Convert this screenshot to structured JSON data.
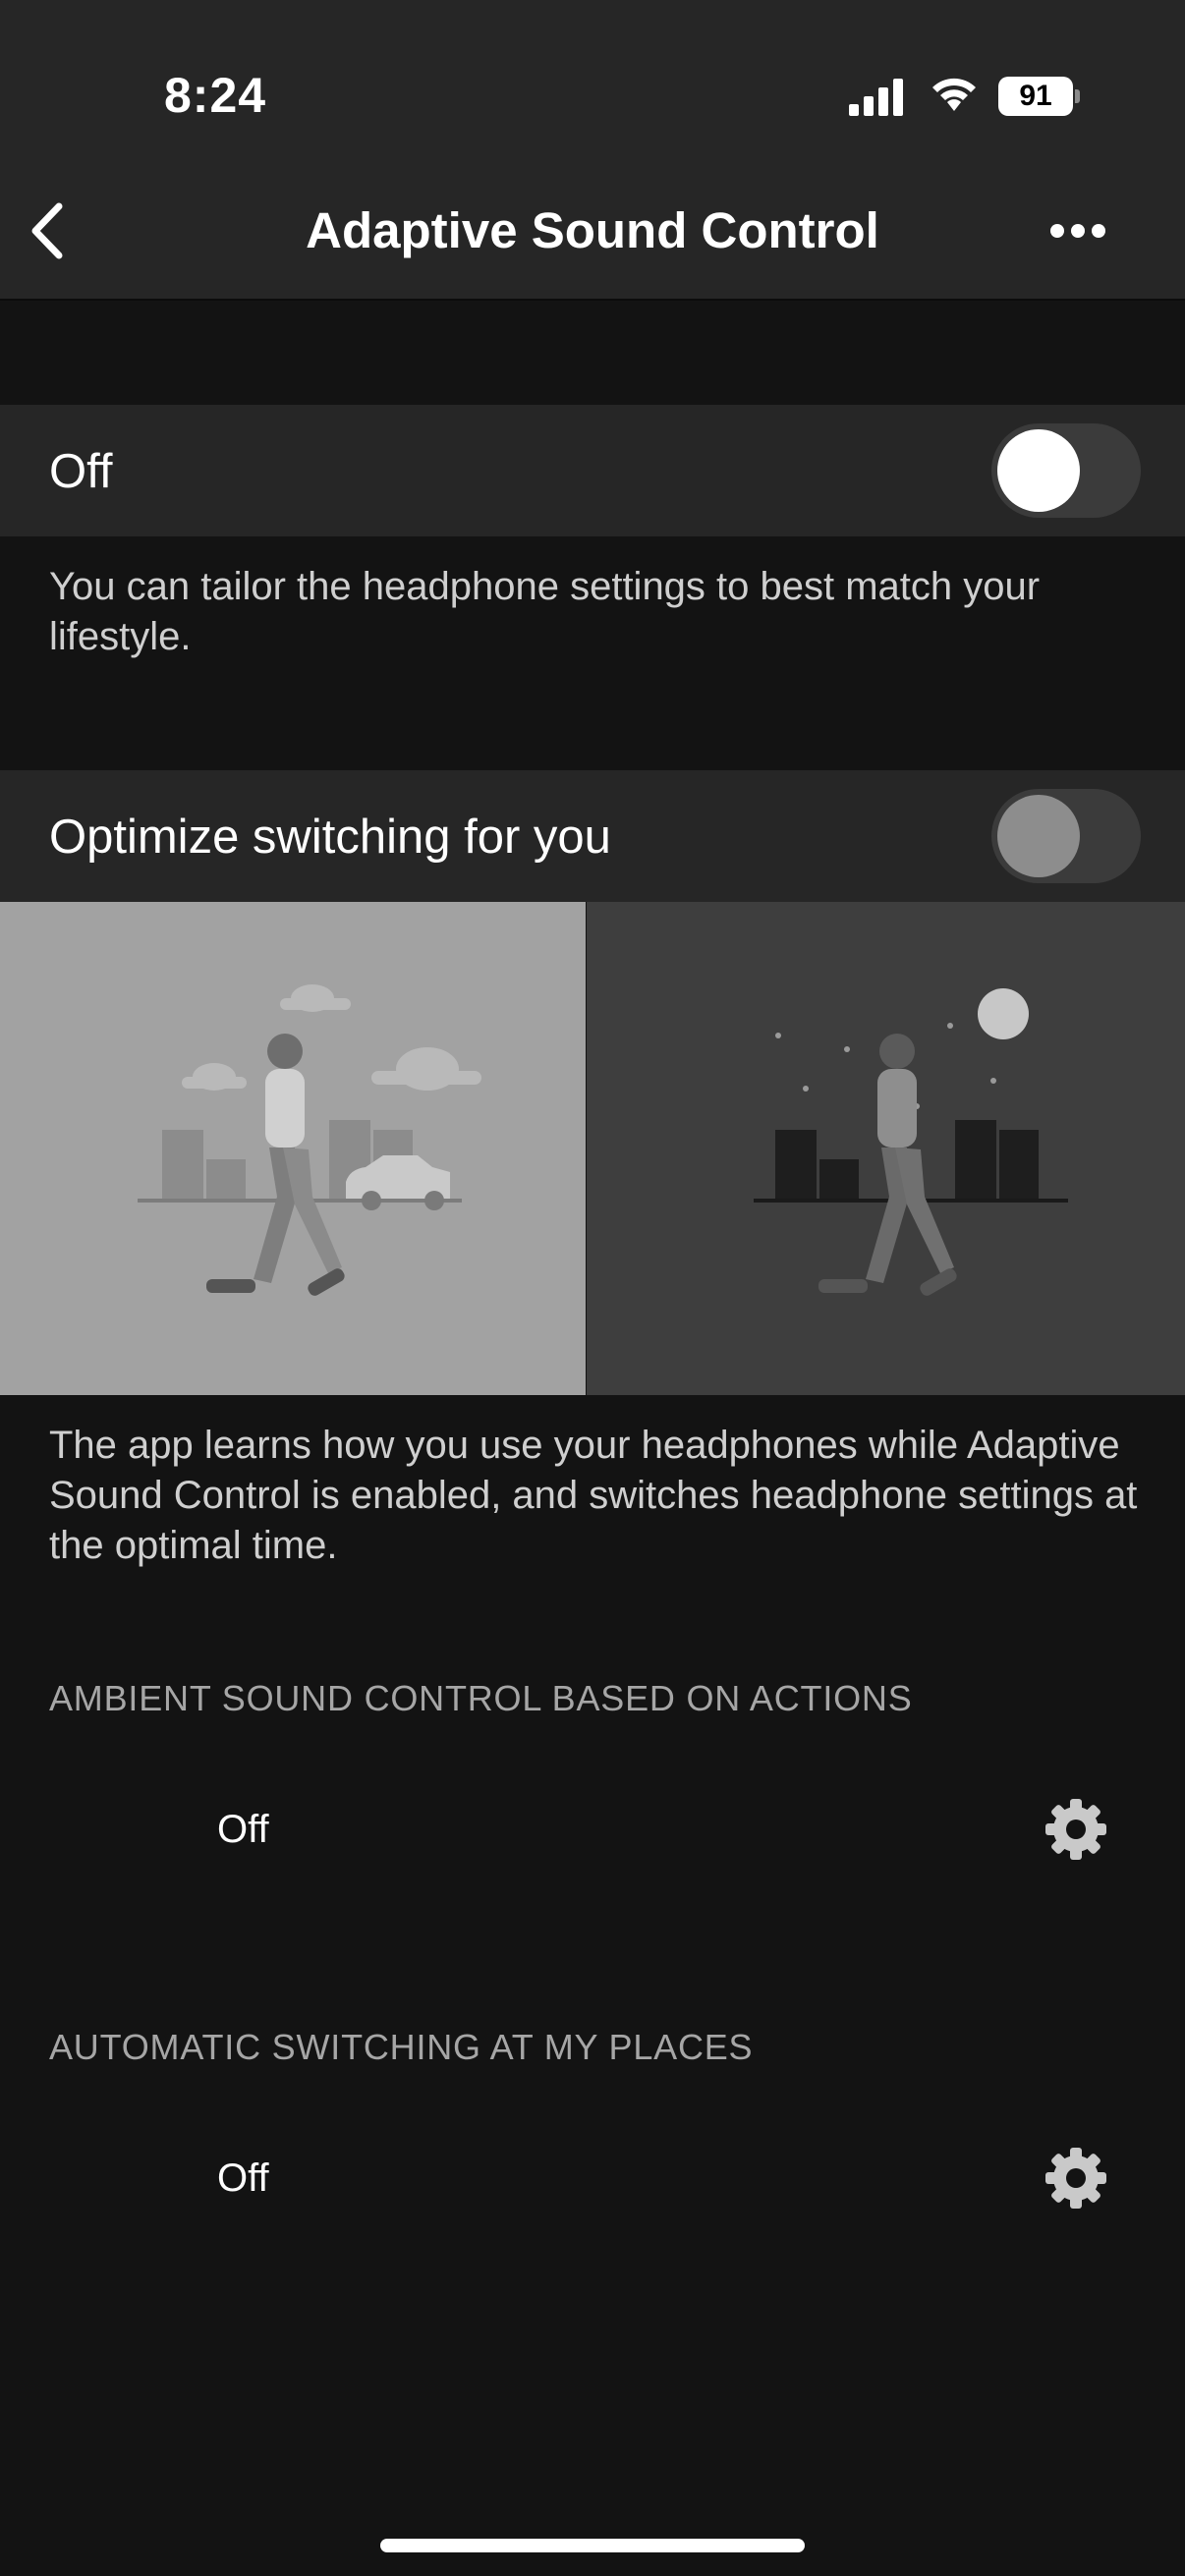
{
  "status_bar": {
    "time": "8:24",
    "battery": "91"
  },
  "nav": {
    "title": "Adaptive Sound Control"
  },
  "main_toggle": {
    "label": "Off",
    "state": "off"
  },
  "main_description": "You can tailor the headphone settings to best match your lifestyle.",
  "optimize": {
    "label": "Optimize switching for you",
    "state": "off"
  },
  "optimize_description": "The app learns how you use your headphones while Adaptive Sound Control is enabled, and switches headphone settings at the optimal time.",
  "ambient_section": {
    "header": "AMBIENT SOUND CONTROL BASED ON ACTIONS",
    "value": "Off"
  },
  "places_section": {
    "header": "AUTOMATIC SWITCHING AT MY PLACES",
    "value": "Off"
  },
  "icons": [
    "back-chevron-icon",
    "more-options-icon",
    "signal-icon",
    "wifi-icon",
    "battery-icon",
    "gear-icon"
  ],
  "colors": {
    "background": "#131313",
    "surface": "#262626",
    "toggle_track": "#3b3b3b",
    "text_secondary": "#a6a6a6"
  }
}
